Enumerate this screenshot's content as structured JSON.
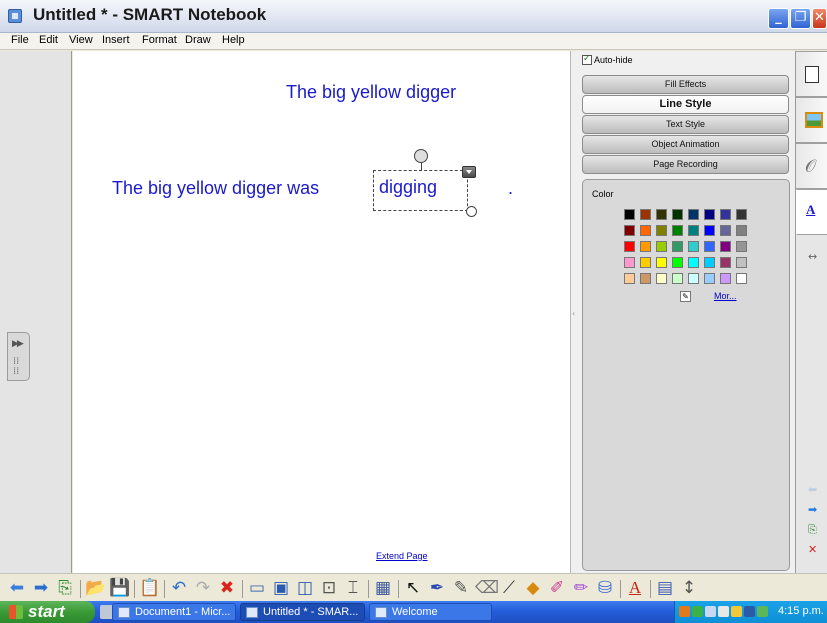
{
  "window": {
    "title": "Untitled * - SMART Notebook",
    "minimize": "_",
    "restore": "❐",
    "close": "✕"
  },
  "menu": [
    "File",
    "Edit",
    "View",
    "Insert",
    "Format",
    "Draw",
    "Help"
  ],
  "canvas": {
    "heading": "The big yellow digger",
    "sentence": "The big yellow digger was",
    "selected_text": "digging",
    "trailing_mark": ".",
    "extend_link": "Extend Page"
  },
  "properties": {
    "autohide_label": "Auto-hide",
    "autohide_checked": true,
    "tabs": [
      "Fill Effects",
      "Line Style",
      "Text Style",
      "Object Animation",
      "Page Recording"
    ],
    "active_tab": "Line Style",
    "color_label": "Color",
    "more_link": "Mor...",
    "palette": [
      [
        "#000000",
        "#993300",
        "#333300",
        "#003300",
        "#003366",
        "#000080",
        "#333399",
        "#333333"
      ],
      [
        "#800000",
        "#ff6600",
        "#808000",
        "#008000",
        "#008080",
        "#0000ff",
        "#666699",
        "#808080"
      ],
      [
        "#ff0000",
        "#ff9900",
        "#99cc00",
        "#339966",
        "#33cccc",
        "#3366ff",
        "#800080",
        "#969696"
      ],
      [
        "#ff99cc",
        "#ffcc00",
        "#ffff00",
        "#00ff00",
        "#00ffff",
        "#00ccff",
        "#993366",
        "#c0c0c0"
      ],
      [
        "#ffcc99",
        "#cc9966",
        "#ffffcc",
        "#ccffcc",
        "#ccffff",
        "#99ccff",
        "#cc99ff",
        "#ffffff"
      ]
    ]
  },
  "sidebar_tabs": [
    {
      "icon": "page-sorter-icon"
    },
    {
      "icon": "gallery-icon"
    },
    {
      "icon": "attachments-icon"
    },
    {
      "icon": "properties-icon"
    }
  ],
  "toolbar_icons": [
    "back-icon",
    "forward-icon",
    "add-page-icon",
    "open-icon",
    "save-icon",
    "paste-icon",
    "undo-icon",
    "redo-icon",
    "delete-icon",
    "screen-shade-icon",
    "full-screen-icon",
    "dual-page-icon",
    "capture-icon",
    "document-camera-icon",
    "table-icon",
    "select-icon",
    "pen-icon",
    "creative-pen-icon",
    "eraser-icon",
    "line-icon",
    "shape-icon",
    "magic-pen-icon",
    "highlighter-icon",
    "fill-icon",
    "text-icon",
    "properties-icon",
    "move-toolbar-icon"
  ],
  "taskbar": {
    "start": "start",
    "tasks": [
      {
        "label": "Document1 - Micr...",
        "active": false
      },
      {
        "label": "Untitled * - SMAR...",
        "active": true
      },
      {
        "label": "Welcome",
        "active": false
      }
    ],
    "clock": "4:15 p.m."
  },
  "colors": {
    "canvas_text": "#1a1acc",
    "link": "#0000cc",
    "taskbar": "#245edb",
    "start": "#3a9a36"
  }
}
